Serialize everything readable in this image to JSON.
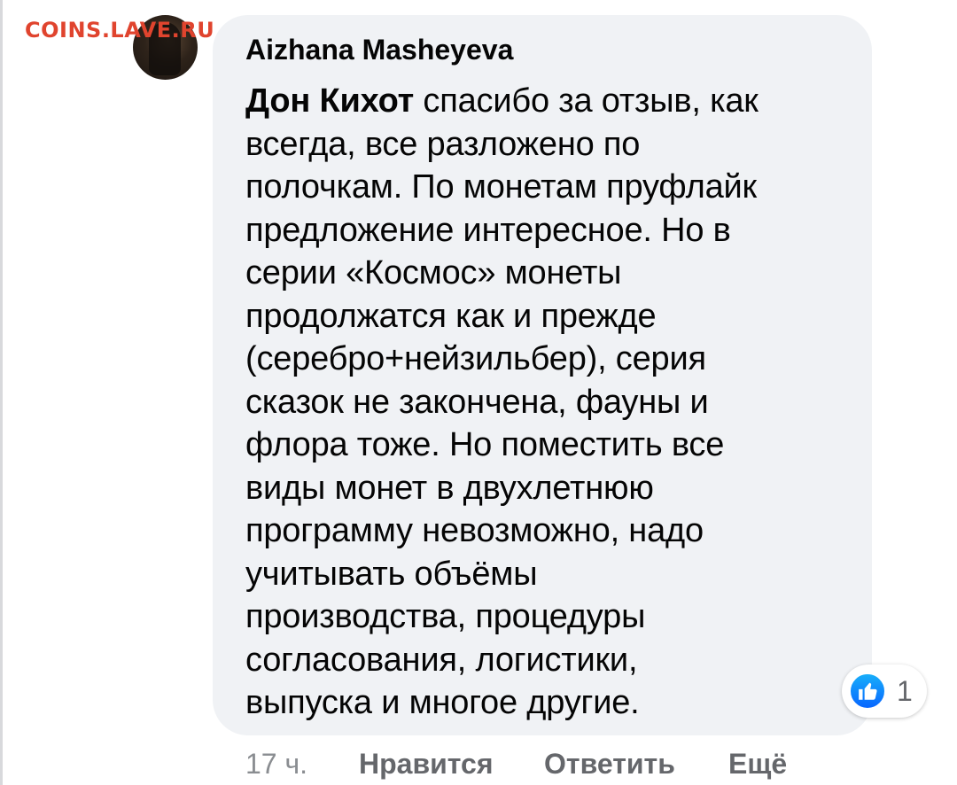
{
  "watermark": "COINS.LAVE.RU",
  "comment": {
    "author": "Aizhana Masheyeva",
    "mention": "Дон Кихот",
    "lines": [
      " спасибо за отзыв, как",
      "всегда, все разложено по",
      "полочкам. По монетам пруфлайк",
      "предложение интересное. Но в",
      "серии «Космос» монеты",
      "продолжатся как и прежде",
      "(серебро+нейзильбер), серия",
      "сказок не закончена, фауны и",
      "флора тоже. Но поместить все",
      "виды монет в двухлетнюю",
      "программу невозможно, надо",
      "учитывать объёмы",
      "производства, процедуры",
      "согласования, логистики,",
      "выпуска и многое другие."
    ],
    "reaction": {
      "icon": "like-icon",
      "count": "1",
      "color": "#0866ff"
    }
  },
  "actions": {
    "time": "17 ч.",
    "like": "Нравится",
    "reply": "Ответить",
    "more": "Ещё"
  }
}
